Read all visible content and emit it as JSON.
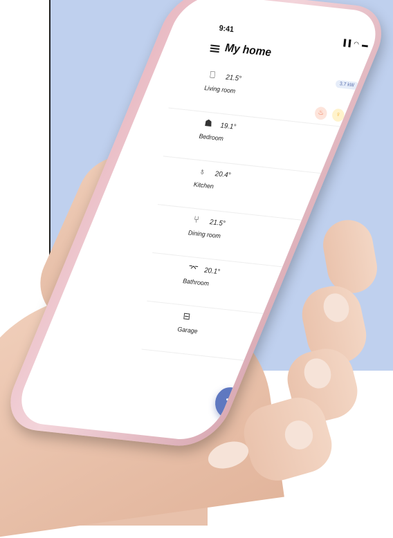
{
  "status_bar": {
    "time": "9:41",
    "icons": "▐▐ ◠ ▬"
  },
  "header": {
    "title": "My home",
    "power": "3.7 kW"
  },
  "rooms": [
    {
      "icon": "sofa-icon",
      "glyph": "⎕",
      "temp": "21.5°",
      "name": "Living room",
      "devices": [
        "heating-on",
        "light-on"
      ]
    },
    {
      "icon": "bed-icon",
      "glyph": "☗",
      "temp": "19.1°",
      "name": "Bedroom",
      "devices": [
        "light-off"
      ]
    },
    {
      "icon": "pot-icon",
      "glyph": "♁",
      "temp": "20.4°",
      "name": "Kitchen",
      "devices": [
        "light-on"
      ]
    },
    {
      "icon": "cutlery-icon",
      "glyph": "⑂",
      "temp": "21.5°",
      "name": "Dining room",
      "devices": [
        "heating-on",
        "light-on"
      ]
    },
    {
      "icon": "bathtub-icon",
      "glyph": "⌤",
      "temp": "20.1°",
      "name": "Bathroom",
      "devices": [
        "light-off"
      ]
    },
    {
      "icon": "garage-icon",
      "glyph": "⊟",
      "temp": "",
      "name": "Garage",
      "devices": [
        "light-off"
      ]
    }
  ],
  "fab": {
    "icon": "dots-grid-icon"
  },
  "colors": {
    "accent": "#5f78c0",
    "heating": "#ef7b57",
    "light_on": "#f4b73c",
    "background_panel": "#bfd0ee"
  }
}
